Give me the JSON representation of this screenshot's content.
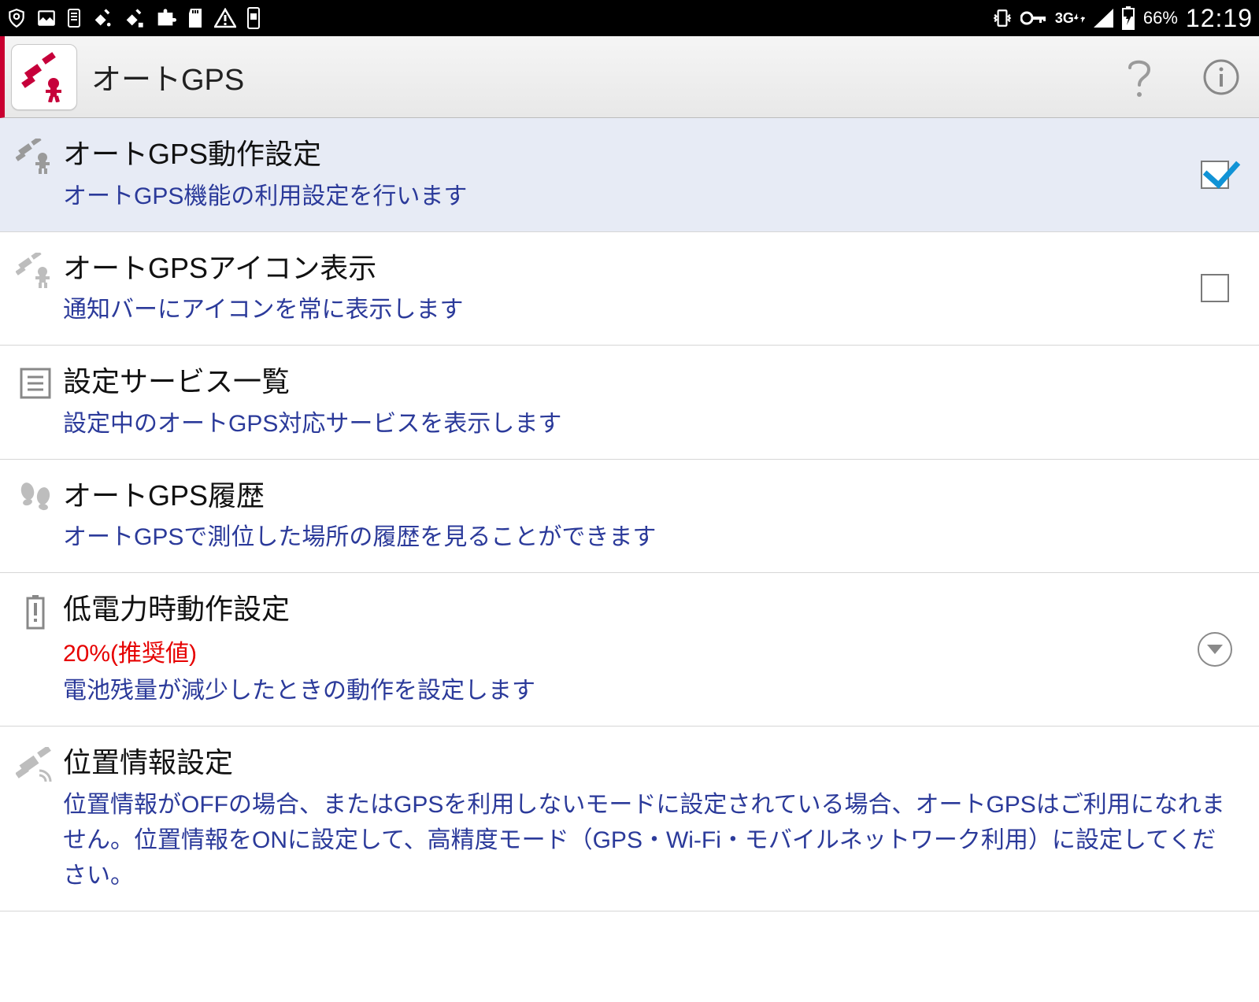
{
  "status_bar": {
    "network_label": "3G",
    "battery_percent": "66%",
    "clock": "12:19"
  },
  "action_bar": {
    "title": "オートGPS"
  },
  "rows": {
    "operation": {
      "title": "オートGPS動作設定",
      "desc": "オートGPS機能の利用設定を行います",
      "checked": "true"
    },
    "icon_display": {
      "title": "オートGPSアイコン表示",
      "desc": "通知バーにアイコンを常に表示します",
      "checked": "false"
    },
    "service_list": {
      "title": "設定サービス一覧",
      "desc": "設定中のオートGPS対応サービスを表示します"
    },
    "history": {
      "title": "オートGPS履歴",
      "desc": "オートGPSで測位した場所の履歴を見ることができます"
    },
    "low_power": {
      "title": "低電力時動作設定",
      "value": "20%(推奨値)",
      "desc": "電池残量が減少したときの動作を設定します"
    },
    "location": {
      "title": "位置情報設定",
      "desc": "位置情報がOFFの場合、またはGPSを利用しないモードに設定されている場合、オートGPSはご利用になれません。位置情報をONに設定して、高精度モード（GPS・Wi-Fi・モバイルネットワーク利用）に設定してください。"
    }
  }
}
